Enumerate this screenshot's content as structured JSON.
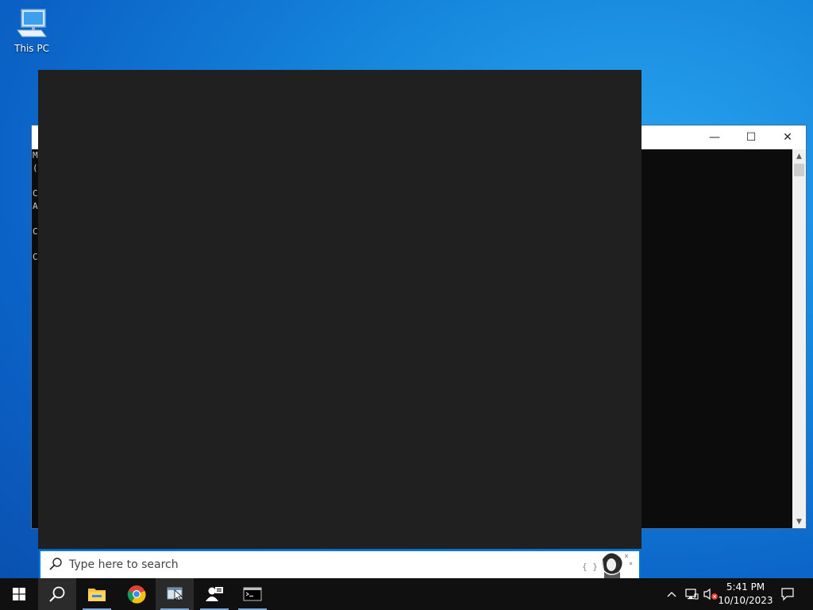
{
  "desktop": {
    "icons": [
      {
        "label": "This PC",
        "icon": "computer-icon"
      }
    ]
  },
  "console_window": {
    "controls": {
      "minimize": "—",
      "maximize": "☐",
      "close": "✕"
    },
    "visible_lines": [
      "M",
      "(",
      "",
      "C",
      "A",
      "",
      "C",
      "",
      "C"
    ]
  },
  "search": {
    "placeholder": "Type here to search",
    "value": ""
  },
  "taskbar": {
    "apps": [
      {
        "name": "start-button",
        "icon": "windows-logo-icon"
      },
      {
        "name": "search-button",
        "icon": "search-icon"
      },
      {
        "name": "file-explorer",
        "icon": "folder-icon"
      },
      {
        "name": "chrome",
        "icon": "chrome-icon"
      },
      {
        "name": "app-window",
        "icon": "window-app-icon"
      },
      {
        "name": "user-app",
        "icon": "user-icon"
      },
      {
        "name": "terminal",
        "icon": "terminal-icon"
      }
    ],
    "tray": {
      "chevron": "^",
      "network": "network-icon",
      "volume": "volume-muted-icon"
    },
    "clock": {
      "time": "5:41 PM",
      "date": "10/10/2023"
    }
  },
  "colors": {
    "accent": "#0078d7",
    "panel": "#202020",
    "taskbar": "#101010"
  }
}
